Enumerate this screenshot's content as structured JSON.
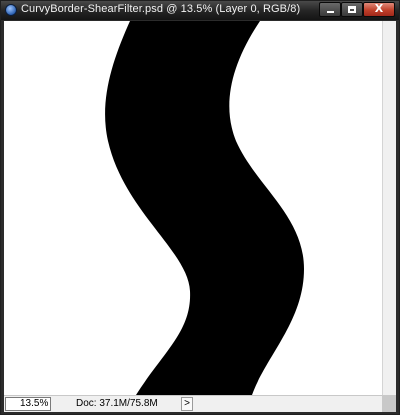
{
  "window": {
    "title": "CurvyBorder-ShearFilter.psd @ 13.5% (Layer 0, RGB/8)",
    "close_glyph": "X",
    "maximize_glyph": "",
    "minimize_glyph": ""
  },
  "canvas": {
    "background": "#ffffff",
    "shape_color": "#000000"
  },
  "statusbar": {
    "zoom": "13.5%",
    "doc_info": "Doc: 37.1M/75.8M",
    "menu_arrow": ">"
  },
  "icons": {
    "app": "photoshop-document-icon",
    "minimize": "minimize-icon",
    "maximize": "maximize-icon",
    "close": "close-icon",
    "status_menu": "chevron-right-icon"
  }
}
